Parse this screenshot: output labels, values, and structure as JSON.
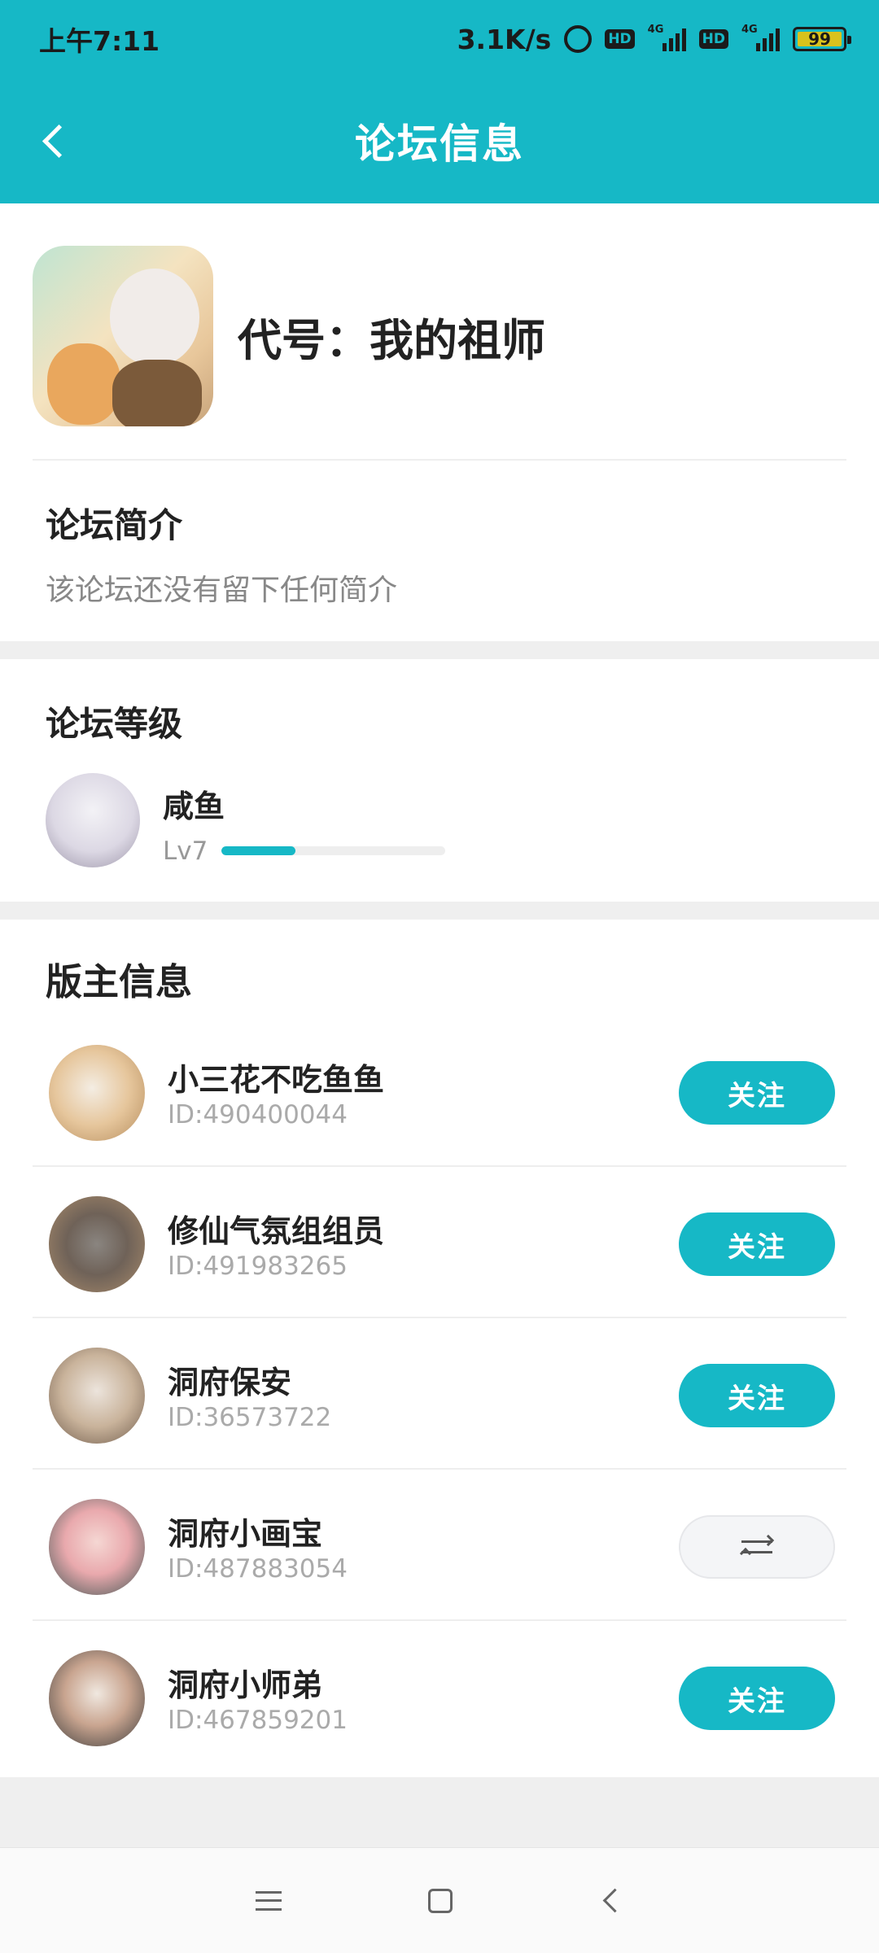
{
  "status_bar": {
    "time": "上午7:11",
    "net_speed": "3.1K/s",
    "battery": "99",
    "hd_label": "HD",
    "net_type": "4G"
  },
  "header": {
    "title": "论坛信息"
  },
  "forum": {
    "name": "代号：我的祖师",
    "intro_title": "论坛简介",
    "intro_text": "该论坛还没有留下任何简介"
  },
  "level": {
    "title": "论坛等级",
    "name": "咸鱼",
    "lv": "Lv7",
    "progress_fraction": 0.33
  },
  "moderators": {
    "title": "版主信息",
    "follow_label": "关注",
    "items": [
      {
        "name": "小三花不吃鱼鱼",
        "id": "ID:490400044",
        "button": "follow"
      },
      {
        "name": "修仙气氛组组员",
        "id": "ID:491983265",
        "button": "follow"
      },
      {
        "name": "洞府保安",
        "id": "ID:36573722",
        "button": "follow"
      },
      {
        "name": "洞府小画宝",
        "id": "ID:487883054",
        "button": "swap"
      },
      {
        "name": "洞府小师弟",
        "id": "ID:467859201",
        "button": "follow"
      }
    ]
  },
  "colors": {
    "accent": "#16b8c6",
    "background": "#efefef"
  }
}
